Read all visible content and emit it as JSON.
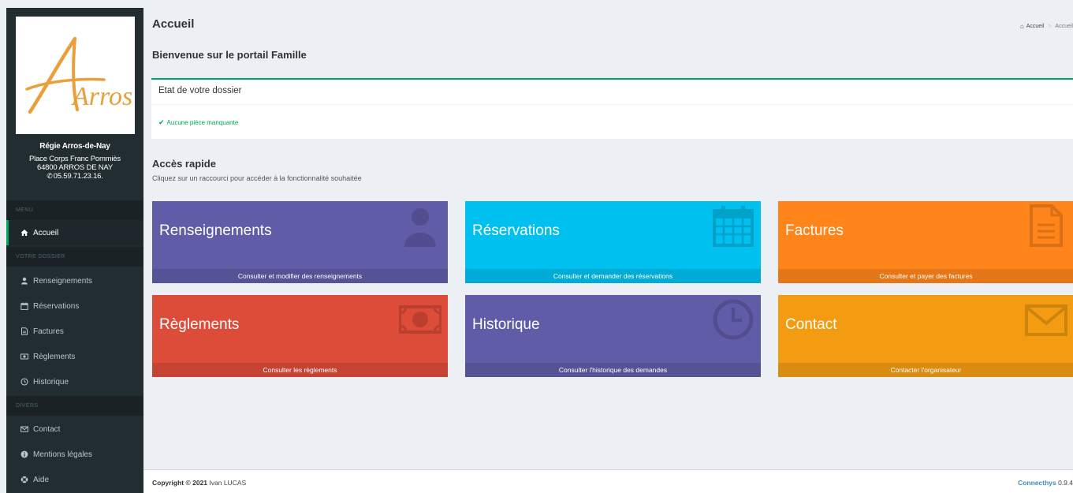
{
  "sidebar": {
    "logo_text": "Arros",
    "org_name": "Régie Arros-de-Nay",
    "address_line1": "Place Corps Franc Pommiès",
    "address_line2": "64800 ARROS DE NAY",
    "phone": "05.59.71.23.16.",
    "sections": {
      "menu": "MENU",
      "dossier": "VOTRE DOSSIER",
      "divers": "DIVERS"
    },
    "items": [
      {
        "label": "Accueil"
      },
      {
        "label": "Renseignements"
      },
      {
        "label": "Réservations"
      },
      {
        "label": "Factures"
      },
      {
        "label": "Règlements"
      },
      {
        "label": "Historique"
      },
      {
        "label": "Contact"
      },
      {
        "label": "Mentions légales"
      },
      {
        "label": "Aide"
      }
    ]
  },
  "header": {
    "title": "Accueil",
    "breadcrumb": [
      "Accueil",
      "Accueil"
    ],
    "welcome": "Bienvenue sur le portail Famille"
  },
  "dossier_box": {
    "title": "Etat de votre dossier",
    "status": "Aucune pièce manquante"
  },
  "quick_access": {
    "title": "Accès rapide",
    "subtitle": "Cliquez sur un raccourci pour accéder à la fonctionnalité souhaitée",
    "tiles": [
      {
        "label": "Renseignements",
        "footer": "Consulter et modifier des renseignements",
        "color": "#605ca8",
        "icon": "user-icon"
      },
      {
        "label": "Réservations",
        "footer": "Consulter et demander des réservations",
        "color": "#00c0ef",
        "icon": "calendar-icon"
      },
      {
        "label": "Factures",
        "footer": "Consulter et payer des factures",
        "color": "#ff851b",
        "icon": "file-icon"
      },
      {
        "label": "Règlements",
        "footer": "Consulter les règlements",
        "color": "#dd4b39",
        "icon": "money-icon"
      },
      {
        "label": "Historique",
        "footer": "Consulter l'historique des demandes",
        "color": "#605ca8",
        "icon": "clock-icon"
      },
      {
        "label": "Contact",
        "footer": "Contacter l'organisateur",
        "color": "#f39c12",
        "icon": "envelope-icon"
      }
    ]
  },
  "footer": {
    "copyright_prefix": "Copyright © 2021",
    "author": "Ivan LUCAS",
    "brand": "Connecthys",
    "version": "0.9.4"
  },
  "colors": {
    "sidebar_bg": "#222d32",
    "active_accent": "#00a65a",
    "link_blue": "#3c8dbc",
    "content_bg": "#ecf0f5"
  }
}
